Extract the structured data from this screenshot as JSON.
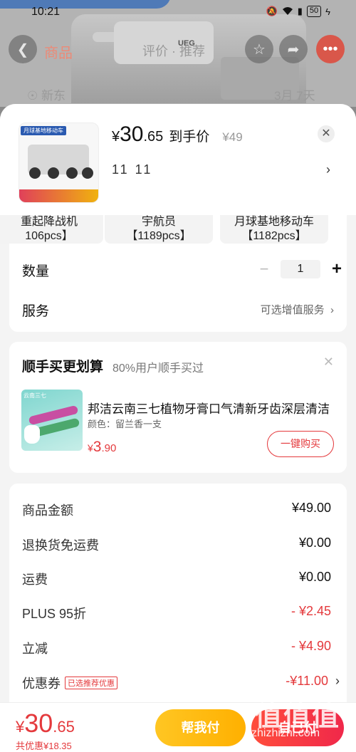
{
  "status": {
    "time": "10:21",
    "battery": "50"
  },
  "background": {
    "tab_left": "商品",
    "tab_mid": "评价 · 推荐",
    "row_left": "☉ 新东",
    "row_right": "3月 7天"
  },
  "product": {
    "thumb_tag": "月球基地移动车",
    "price_symbol": "¥",
    "price_int": "30",
    "price_dec": ".65",
    "price_label": "到手价",
    "original_price": "¥49",
    "selected_spec": "11 11"
  },
  "options": [
    {
      "line1": "重起降战机",
      "line2": "106pcs】"
    },
    {
      "line1": "宇航员",
      "line2": "【1189pcs】"
    },
    {
      "line1": "月球基地移动车",
      "line2": "【1182pcs】"
    }
  ],
  "quantity": {
    "label": "数量",
    "value": "1",
    "minus": "−",
    "plus": "+"
  },
  "service": {
    "label": "服务",
    "value": "可选增值服务"
  },
  "addon": {
    "title": "顺手买更划算",
    "subtitle": "80%用户顺手买过",
    "name": "邦洁云南三七植物牙膏口气清新牙齿深层清洁",
    "spec": "颜色：留兰香一支",
    "price_symbol": "¥",
    "price_int": "3",
    "price_dec": ".90",
    "buy_label": "一键购买"
  },
  "fees": [
    {
      "label": "商品金额",
      "value": "¥49.00"
    },
    {
      "label": "退换货免运费",
      "value": "¥0.00"
    },
    {
      "label": "运费",
      "value": "¥0.00"
    },
    {
      "label": "PLUS 95折",
      "value": "- ¥2.45"
    },
    {
      "label": "立减",
      "value": "- ¥4.90"
    },
    {
      "label": "优惠券",
      "tag": "已选推荐优惠",
      "value": "-¥11.00"
    }
  ],
  "footer": {
    "price_symbol": "¥",
    "price_int": "30",
    "price_dec": ".65",
    "saved": "共优惠¥18.35",
    "help_pay": "帮我付",
    "self_pay": "自己付"
  },
  "watermark": {
    "logo": "值值值",
    "site": "zhizhizhi.com"
  },
  "colors": {
    "accent_red": "#e4393c",
    "help_yellow": "#ffb000",
    "pay_red": "#f0284a"
  }
}
